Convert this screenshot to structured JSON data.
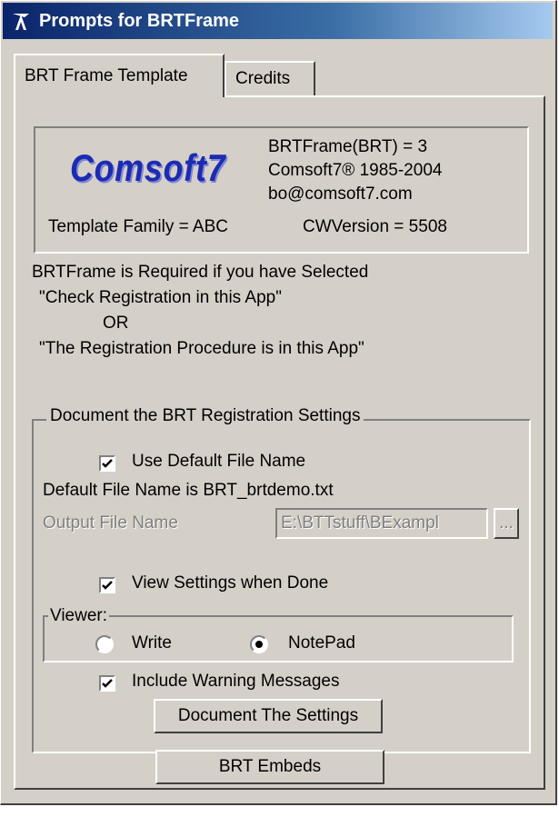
{
  "window": {
    "title": "Prompts for BRTFrame"
  },
  "tabs": [
    {
      "label": "BRT Frame Template"
    },
    {
      "label": "Credits"
    }
  ],
  "info": {
    "logo": "Comsoft7",
    "line1": "BRTFrame(BRT) = 3",
    "line2": "Comsoft7® 1985-2004",
    "line3": "bo@comsoft7.com",
    "template_family": "Template Family = ABC",
    "cw_version": "CWVersion = 5508"
  },
  "notes": {
    "line1": "BRTFrame is Required if you have Selected",
    "line2": "\"Check Registration in this App\"",
    "line3": "OR",
    "line4": "\"The Registration Procedure is in this App\""
  },
  "settings": {
    "group_label": "Document the BRT Registration Settings",
    "use_default_label": "Use Default File Name",
    "use_default_checked": true,
    "default_file_text": "Default File Name is BRT_brtdemo.txt",
    "output_label": "Output File Name",
    "output_value": "E:\\BTTstuff\\BExampl",
    "browse_label": "...",
    "view_settings_label": "View Settings when Done",
    "view_settings_checked": true,
    "viewer_label": "Viewer:",
    "viewer_options": [
      "Write",
      "NotePad"
    ],
    "viewer_selected": "NotePad",
    "include_warning_label": "Include Warning Messages",
    "include_warning_checked": true,
    "document_button": "Document The Settings"
  },
  "embeds_button": "BRT Embeds",
  "colors": {
    "titlebar": "#0a246a",
    "face": "#d4d0c8",
    "logo": "#1c2bb0"
  }
}
